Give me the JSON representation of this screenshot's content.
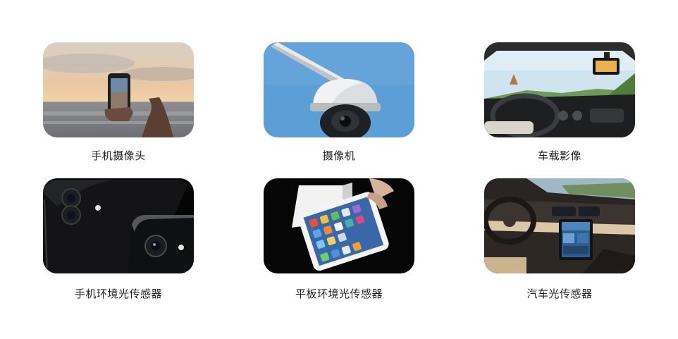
{
  "items": [
    {
      "label": "手机摄像头",
      "image": "phone-camera-sunset-photo"
    },
    {
      "label": "摄像机",
      "image": "dome-security-camera-photo"
    },
    {
      "label": "车载影像",
      "image": "dashcam-car-interior-photo"
    },
    {
      "label": "手机环境光传感器",
      "image": "black-smartphones-closeup-photo"
    },
    {
      "label": "平板环境光传感器",
      "image": "white-tablet-in-hand-photo"
    },
    {
      "label": "汽车光传感器",
      "image": "car-dashboard-screen-photo"
    }
  ]
}
